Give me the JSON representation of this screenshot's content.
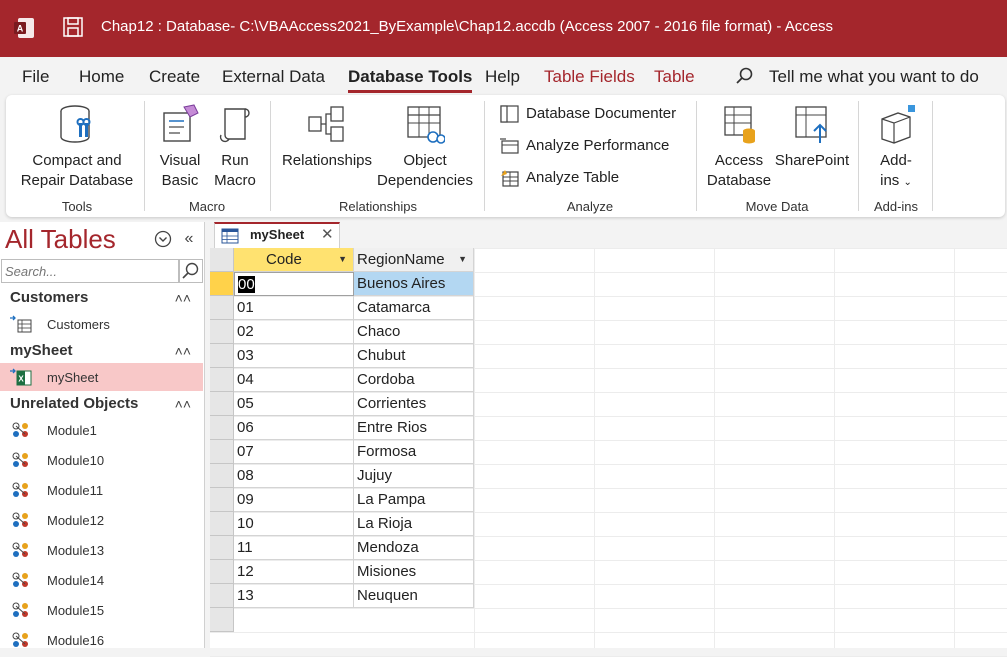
{
  "title_bar": {
    "title": "Chap12 : Database- C:\\VBAAccess2021_ByExample\\Chap12.accdb (Access 2007 - 2016 file format)  -  Access"
  },
  "menu": {
    "tabs": [
      {
        "label": "File"
      },
      {
        "label": "Home"
      },
      {
        "label": "Create"
      },
      {
        "label": "External Data"
      },
      {
        "label": "Database Tools"
      },
      {
        "label": "Help"
      },
      {
        "label": "Table Fields"
      },
      {
        "label": "Table"
      }
    ],
    "active_tab": "Database Tools",
    "tell_me": "Tell me what you want to do"
  },
  "ribbon": {
    "groups": {
      "tools": "Tools",
      "macro": "Macro",
      "relationships": "Relationships",
      "analyze": "Analyze",
      "move_data": "Move Data",
      "add_ins": "Add-ins"
    },
    "buttons": {
      "compact_l1": "Compact and",
      "compact_l2": "Repair Database",
      "visual_l1": "Visual",
      "visual_l2": "Basic",
      "run_l1": "Run",
      "run_l2": "Macro",
      "relationships": "Relationships",
      "objdep_l1": "Object",
      "objdep_l2": "Dependencies",
      "db_documenter": "Database Documenter",
      "analyze_performance": "Analyze Performance",
      "analyze_table": "Analyze Table",
      "access_l1": "Access",
      "access_l2": "Database",
      "sharepoint": "SharePoint",
      "addins_l1": "Add-",
      "addins_l2": "ins"
    }
  },
  "nav_pane": {
    "title": "All Tables",
    "search_placeholder": "Search...",
    "groups": [
      {
        "name": "Customers",
        "items": [
          "Customers"
        ]
      },
      {
        "name": "mySheet",
        "items": [
          "mySheet"
        ]
      },
      {
        "name": "Unrelated Objects",
        "items": [
          "Module1",
          "Module10",
          "Module11",
          "Module12",
          "Module13",
          "Module14",
          "Module15",
          "Module16"
        ]
      }
    ]
  },
  "document": {
    "tab_label": "mySheet",
    "columns": [
      "Code",
      "RegionName"
    ],
    "rows": [
      [
        "00",
        "Buenos Aires"
      ],
      [
        "01",
        "Catamarca"
      ],
      [
        "02",
        "Chaco"
      ],
      [
        "03",
        "Chubut"
      ],
      [
        "04",
        "Cordoba"
      ],
      [
        "05",
        "Corrientes"
      ],
      [
        "06",
        "Entre Rios"
      ],
      [
        "07",
        "Formosa"
      ],
      [
        "08",
        "Jujuy"
      ],
      [
        "09",
        "La Pampa"
      ],
      [
        "10",
        "La Rioja"
      ],
      [
        "11",
        "Mendoza"
      ],
      [
        "12",
        "Misiones"
      ],
      [
        "13",
        "Neuquen"
      ]
    ]
  },
  "colors": {
    "accent": "#a4262c",
    "selected_nav": "#f8c8c8",
    "sorted_header": "#ffe270",
    "selected_cell": "#b3d7f2"
  }
}
